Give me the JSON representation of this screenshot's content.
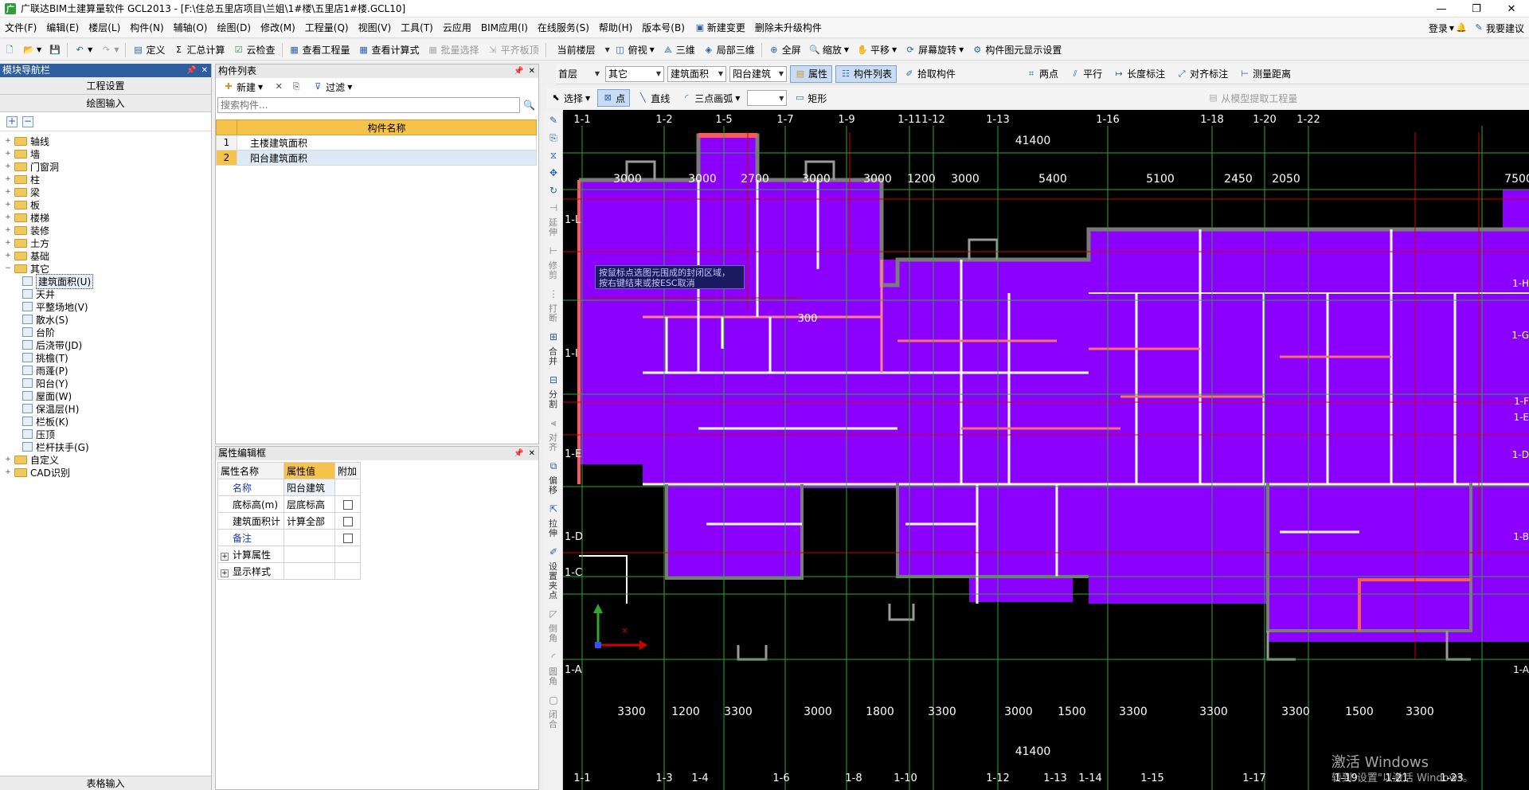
{
  "app": {
    "logo_char": "广",
    "title": "广联达BIM土建算量软件 GCL2013 - [F:\\住总五里店项目\\兰姐\\1#楼\\五里店1#楼.GCL10]"
  },
  "window_controls": {
    "minimize": "—",
    "maximize": "❐",
    "close": "✕"
  },
  "menu": {
    "items": [
      "文件(F)",
      "编辑(E)",
      "楼层(L)",
      "构件(N)",
      "辅轴(O)",
      "绘图(D)",
      "修改(M)",
      "工程量(Q)",
      "视图(V)",
      "工具(T)",
      "云应用",
      "BIM应用(I)",
      "在线服务(S)",
      "帮助(H)",
      "版本号(B)"
    ],
    "new_change": "新建变更",
    "delete_unused": "删除未升级构件",
    "login": "登录",
    "suggest": "我要建议"
  },
  "toolbar1": {
    "define": "定义",
    "sum_calc": "汇总计算",
    "cloud_check": "云检查",
    "view_quantity": "查看工程量",
    "view_formula": "查看计算式",
    "batch_select": "批量选择",
    "flush_slab": "平齐板顶",
    "current_floor_label": "当前楼层",
    "top_view": "俯视",
    "three_d": "三维",
    "partial_3d": "局部三维",
    "fullscreen": "全屏",
    "zoom": "缩放",
    "pan": "平移",
    "screen_rotate": "屏幕旋转",
    "display_settings": "构件图元显示设置"
  },
  "nav_panel": {
    "title": "模块导航栏",
    "tab_project": "工程设置",
    "tab_draw": "绘图输入",
    "tab_table": "表格输入",
    "tree": [
      {
        "label": "轴线",
        "type": "folder",
        "exp": "+"
      },
      {
        "label": "墙",
        "type": "folder",
        "exp": "+"
      },
      {
        "label": "门窗洞",
        "type": "folder",
        "exp": "+"
      },
      {
        "label": "柱",
        "type": "folder",
        "exp": "+"
      },
      {
        "label": "梁",
        "type": "folder",
        "exp": "+"
      },
      {
        "label": "板",
        "type": "folder",
        "exp": "+"
      },
      {
        "label": "楼梯",
        "type": "folder",
        "exp": "+"
      },
      {
        "label": "装修",
        "type": "folder",
        "exp": "+"
      },
      {
        "label": "土方",
        "type": "folder",
        "exp": "+"
      },
      {
        "label": "基础",
        "type": "folder",
        "exp": "+"
      },
      {
        "label": "其它",
        "type": "folder",
        "exp": "−"
      },
      {
        "label": "建筑面积(U)",
        "type": "leaf",
        "selected": true
      },
      {
        "label": "天井",
        "type": "leaf"
      },
      {
        "label": "平整场地(V)",
        "type": "leaf"
      },
      {
        "label": "散水(S)",
        "type": "leaf"
      },
      {
        "label": "台阶",
        "type": "leaf"
      },
      {
        "label": "后浇带(JD)",
        "type": "leaf"
      },
      {
        "label": "挑檐(T)",
        "type": "leaf"
      },
      {
        "label": "雨蓬(P)",
        "type": "leaf"
      },
      {
        "label": "阳台(Y)",
        "type": "leaf"
      },
      {
        "label": "屋面(W)",
        "type": "leaf"
      },
      {
        "label": "保温层(H)",
        "type": "leaf"
      },
      {
        "label": "栏板(K)",
        "type": "leaf"
      },
      {
        "label": "压顶",
        "type": "leaf"
      },
      {
        "label": "栏杆扶手(G)",
        "type": "leaf"
      },
      {
        "label": "自定义",
        "type": "folder",
        "exp": "+"
      },
      {
        "label": "CAD识别",
        "type": "folder",
        "exp": "+"
      }
    ]
  },
  "comp_panel": {
    "title": "构件列表",
    "new_label": "新建",
    "filter_label": "过滤",
    "search_placeholder": "搜索构件...",
    "col_name": "构件名称",
    "rows": [
      {
        "idx": "1",
        "name": "主楼建筑面积"
      },
      {
        "idx": "2",
        "name": "阳台建筑面积"
      }
    ]
  },
  "prop_panel": {
    "title": "属性编辑框",
    "col_name": "属性名称",
    "col_value": "属性值",
    "col_add": "附加",
    "rows": [
      {
        "name": "名称",
        "value": "阳台建筑"
      },
      {
        "name": "底标高(m)",
        "value": "层底标高"
      },
      {
        "name": "建筑面积计",
        "value": "计算全部"
      },
      {
        "name": "备注",
        "value": ""
      }
    ],
    "group_calc": "计算属性",
    "group_display": "显示样式"
  },
  "draw_toolbar": {
    "floor": "首层",
    "category": "其它",
    "type": "建筑面积",
    "component": "阳台建筑",
    "attribute": "属性",
    "comp_list": "构件列表",
    "pick_comp": "拾取构件",
    "two_point": "两点",
    "parallel": "平行",
    "length_dim": "长度标注",
    "aligned_dim": "对齐标注",
    "measure": "测量距离",
    "select": "选择",
    "point": "点",
    "line": "直线",
    "arc3": "三点画弧",
    "rect": "矩形",
    "extract_qty": "从模型提取工程量"
  },
  "vtools": {
    "extend": "延伸",
    "trim": "修剪",
    "break": "打断",
    "merge": "合并",
    "split": "分割",
    "align": "对齐",
    "offset": "偏移",
    "stretch": "拉伸",
    "set_grip": "设置夹点",
    "chamfer": "倒角",
    "fillet": "圆角",
    "close": "闭合"
  },
  "canvas": {
    "tooltip_line1": "按鼠标点选图元围成的封闭区域，",
    "tooltip_line2": "按右键结束或按ESC取消",
    "total_top": "41400",
    "total_bottom": "41400",
    "label_300": "300",
    "top_axes": [
      "1-1",
      "1-2",
      "1-5",
      "1-7",
      "1-9",
      "1-11",
      "1-12",
      "1-13",
      "1-16",
      "1-18",
      "1-20",
      "1-22"
    ],
    "top_dims": [
      "3000",
      "3000",
      "2700",
      "3000",
      "3000",
      "1200",
      "3000",
      "5400",
      "5100",
      "2450",
      "2050",
      "7500"
    ],
    "bottom_axes": [
      "1-1",
      "1-3",
      "1-4",
      "1-6",
      "1-8",
      "1-10",
      "1-12",
      "1-13",
      "1-14",
      "1-15",
      "1-17",
      "1-19",
      "1-21",
      "1-23"
    ],
    "bottom_dims": [
      "3300",
      "1200",
      "3300",
      "3000",
      "1800",
      "3300",
      "3000",
      "1500",
      "3300",
      "3300",
      "3300",
      "1500",
      "3300"
    ],
    "left_axes": [
      "1-L",
      "1-I",
      "1-E",
      "1-D",
      "1-C",
      "1-A"
    ],
    "right_axes": [
      "1-H",
      "1-G",
      "1-F",
      "1-E",
      "1-D",
      "1-B",
      "1-A"
    ],
    "watermark_1": "激活 Windows",
    "watermark_2": "转到\"设置\"以激活 Windows。"
  },
  "colors": {
    "fill": "#8b00ff",
    "wall_red": "#ff5a5a",
    "axis_green": "#2fa82f",
    "accent_panel": "#2f5ea0",
    "header_orange": "#f5c24c"
  }
}
